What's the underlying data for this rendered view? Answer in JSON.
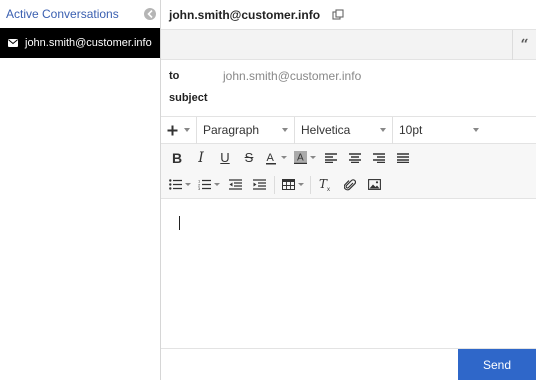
{
  "sidebar": {
    "title": "Active Conversations",
    "conversations": [
      {
        "email": "john.smith@customer.info",
        "selected": true
      }
    ]
  },
  "header": {
    "email": "john.smith@customer.info"
  },
  "compose": {
    "to_label": "to",
    "to_value": "john.smith@customer.info",
    "subject_label": "subject",
    "subject_value": ""
  },
  "toolbar": {
    "block_format": "Paragraph",
    "font_family": "Helvetica",
    "font_size": "10pt",
    "icons": [
      "plus-icon",
      "bold-icon",
      "italic-icon",
      "underline-icon",
      "strikethrough-icon",
      "text-color-icon",
      "highlight-icon",
      "align-left-icon",
      "align-center-icon",
      "align-right-icon",
      "justify-icon",
      "bullet-list-icon",
      "numbered-list-icon",
      "outdent-icon",
      "indent-icon",
      "table-icon",
      "clear-format-icon",
      "attachment-icon",
      "image-icon"
    ]
  },
  "footer": {
    "send_label": "Send"
  },
  "colors": {
    "accent": "#2f67c9",
    "sidebar_title": "#3a5fb0",
    "selected_bg": "#000000"
  }
}
